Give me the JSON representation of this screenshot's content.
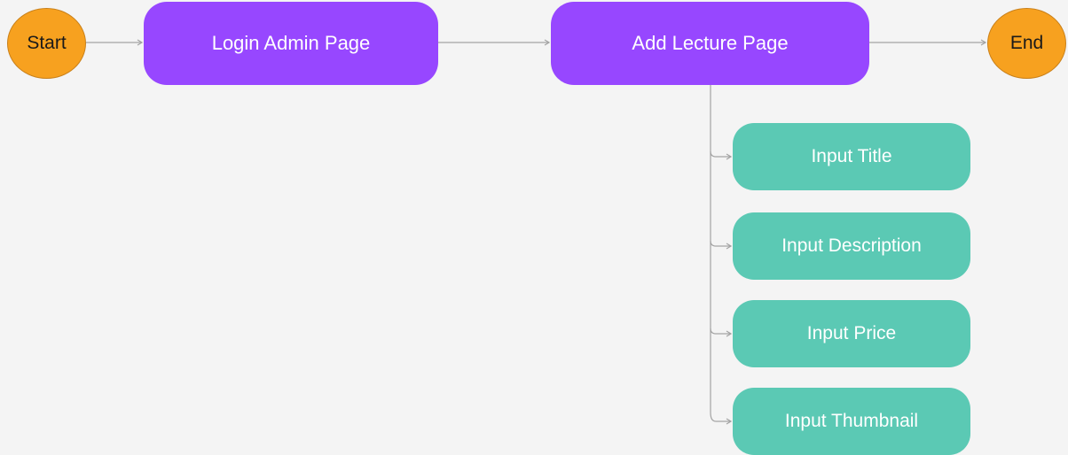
{
  "colors": {
    "background": "#f4f4f4",
    "terminal_fill": "#f7a11f",
    "page_fill": "#9747ff",
    "step_fill": "#5bc9b4",
    "connector": "#a3a3a3"
  },
  "nodes": {
    "start": {
      "label": "Start"
    },
    "login": {
      "label": "Login Admin Page"
    },
    "add_lecture": {
      "label": "Add Lecture Page"
    },
    "end": {
      "label": "End"
    },
    "inputs": [
      {
        "label": "Input Title"
      },
      {
        "label": "Input Description"
      },
      {
        "label": "Input Price"
      },
      {
        "label": "Input Thumbnail"
      }
    ]
  }
}
